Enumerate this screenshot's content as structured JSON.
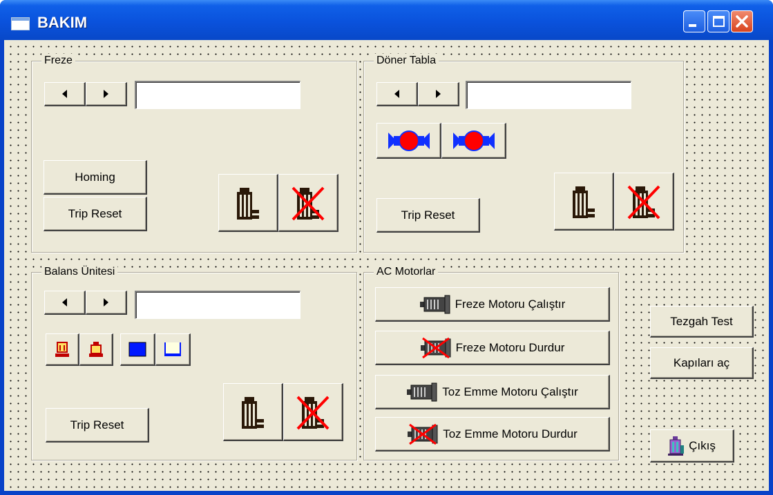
{
  "window": {
    "title": "BAKIM"
  },
  "freze": {
    "label": "Freze",
    "homing_label": "Homing",
    "trip_reset_label": "Trip Reset",
    "value": ""
  },
  "doner_tabla": {
    "label": "Döner Tabla",
    "trip_reset_label": "Trip Reset",
    "value": ""
  },
  "balans": {
    "label": "Balans Ünitesi",
    "trip_reset_label": "Trip Reset",
    "value": ""
  },
  "ac_motorlar": {
    "label": "AC Motorlar",
    "buttons": [
      "Freze Motoru Çalıştır",
      "Freze Motoru Durdur",
      "Toz Emme Motoru Çalıştır",
      "Toz Emme Motoru Durdur"
    ]
  },
  "side": {
    "tezgah_test_label": "Tezgah Test",
    "kapilari_ac_label": "Kapıları aç",
    "cikis_label": "Çıkış"
  },
  "icons": {
    "window": "window-icon",
    "minimize": "minimize-icon",
    "maximize": "maximize-icon",
    "close": "close-icon",
    "motor_start": "motor-icon",
    "motor_stop": "motor-stop-icon",
    "rotate": "rotate-icon",
    "exit": "exit-icon"
  },
  "colors": {
    "titlebar": "#0a52dc",
    "client_bg": "#ece9d8",
    "close_button": "#d8441f",
    "stop_cross": "#ff0000",
    "rotate_blue": "#1030ff",
    "rotate_red": "#ff0000"
  }
}
